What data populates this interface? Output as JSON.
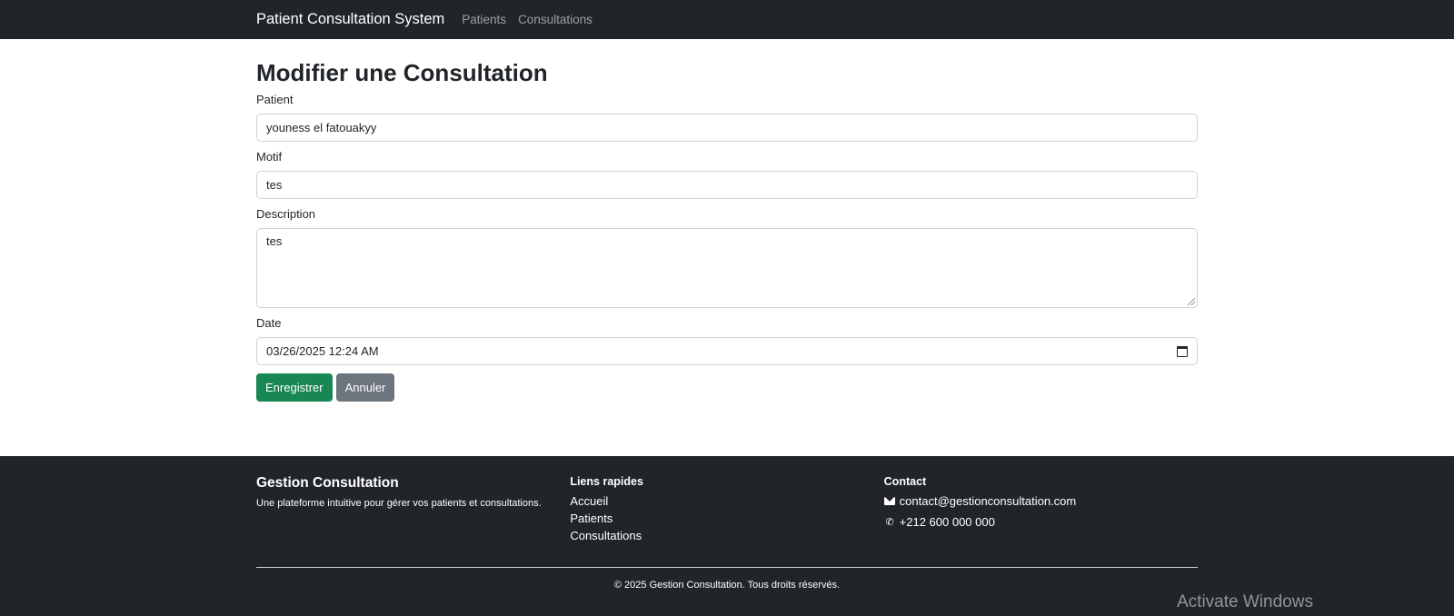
{
  "navbar": {
    "brand": "Patient Consultation System",
    "links": [
      "Patients",
      "Consultations"
    ]
  },
  "form": {
    "title": "Modifier une Consultation",
    "patient_label": "Patient",
    "patient_value": "youness el fatouakyy",
    "motif_label": "Motif",
    "motif_value": "tes",
    "description_label": "Description",
    "description_value": "tes",
    "date_label": "Date",
    "date_value": "03/26/2025 12:24 AM",
    "save_label": "Enregistrer",
    "cancel_label": "Annuler"
  },
  "footer": {
    "title": "Gestion Consultation",
    "description": "Une plateforme intuitive pour gérer vos patients et consultations.",
    "links_heading": "Liens rapides",
    "links": [
      "Accueil",
      "Patients",
      "Consultations"
    ],
    "contact_heading": "Contact",
    "email": "contact@gestionconsultation.com",
    "phone": "+212 600 000 000",
    "copyright": "© 2025 Gestion Consultation. Tous droits réservés."
  },
  "watermark": "Activate Windows",
  "colors": {
    "dark": "#212529",
    "success": "#198754",
    "secondary": "#6c757d"
  }
}
